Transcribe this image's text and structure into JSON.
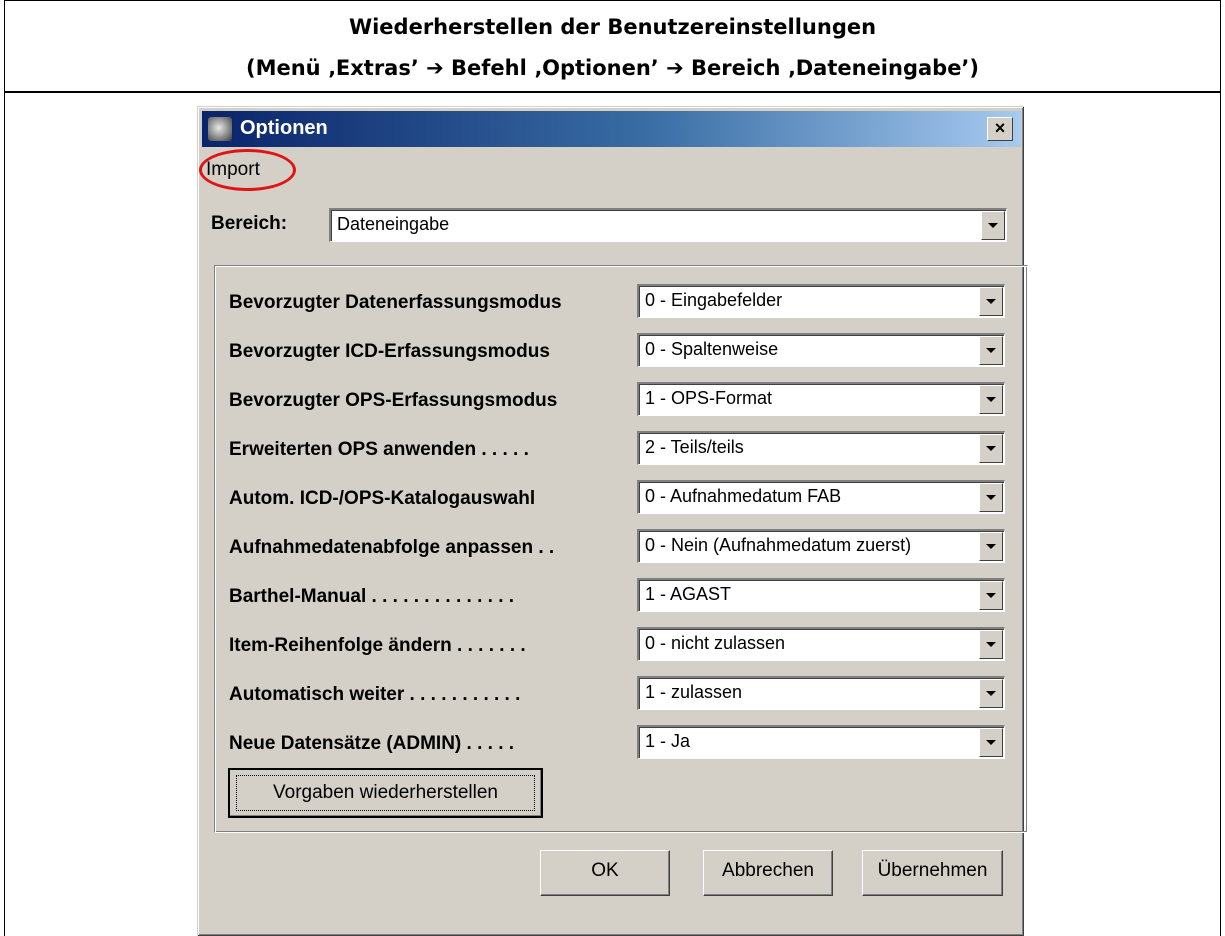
{
  "document": {
    "title_line1": "Wiederherstellen der Benutzereinstellungen",
    "title_line2": "(Menü ‚Extras’ ➔ Befehl ‚Optionen’ ➔ Bereich ‚Dateneingabe’)"
  },
  "dialog": {
    "title": "Optionen",
    "close_label": "×",
    "menu": {
      "import_label": "Import"
    },
    "bereich": {
      "label": "Bereich:",
      "value": "Dateneingabe"
    },
    "options": [
      {
        "label": "Bevorzugter Datenerfassungsmodus",
        "value": "0 - Eingabefelder"
      },
      {
        "label": "Bevorzugter ICD-Erfassungsmodus",
        "value": "0 - Spaltenweise"
      },
      {
        "label": "Bevorzugter OPS-Erfassungsmodus",
        "value": "1 - OPS-Format"
      },
      {
        "label": "Erweiterten OPS anwenden . . . . .",
        "value": "2 - Teils/teils"
      },
      {
        "label": "Autom. ICD-/OPS-Katalogauswahl",
        "value": "0 - Aufnahmedatum FAB"
      },
      {
        "label": "Aufnahmedatenabfolge anpassen . .",
        "value": "0 - Nein (Aufnahmedatum zuerst)"
      },
      {
        "label": "Barthel-Manual . . . . . . . . . . . . . .",
        "value": "1 - AGAST"
      },
      {
        "label": "Item-Reihenfolge ändern . . . . . . .",
        "value": "0 - nicht zulassen"
      },
      {
        "label": "Automatisch weiter . . . . . . . . . . .",
        "value": "1 - zulassen"
      },
      {
        "label": "Neue Datensätze (ADMIN) . . . . .",
        "value": "1 - Ja"
      }
    ],
    "restore_button": "Vorgaben wiederherstellen",
    "buttons": {
      "ok": "OK",
      "cancel": "Abbrechen",
      "apply": "Übernehmen"
    }
  },
  "colors": {
    "highlight_circle": "#e01414",
    "titlebar_start": "#0a246a",
    "dialog_bg": "#d4d0c8"
  }
}
